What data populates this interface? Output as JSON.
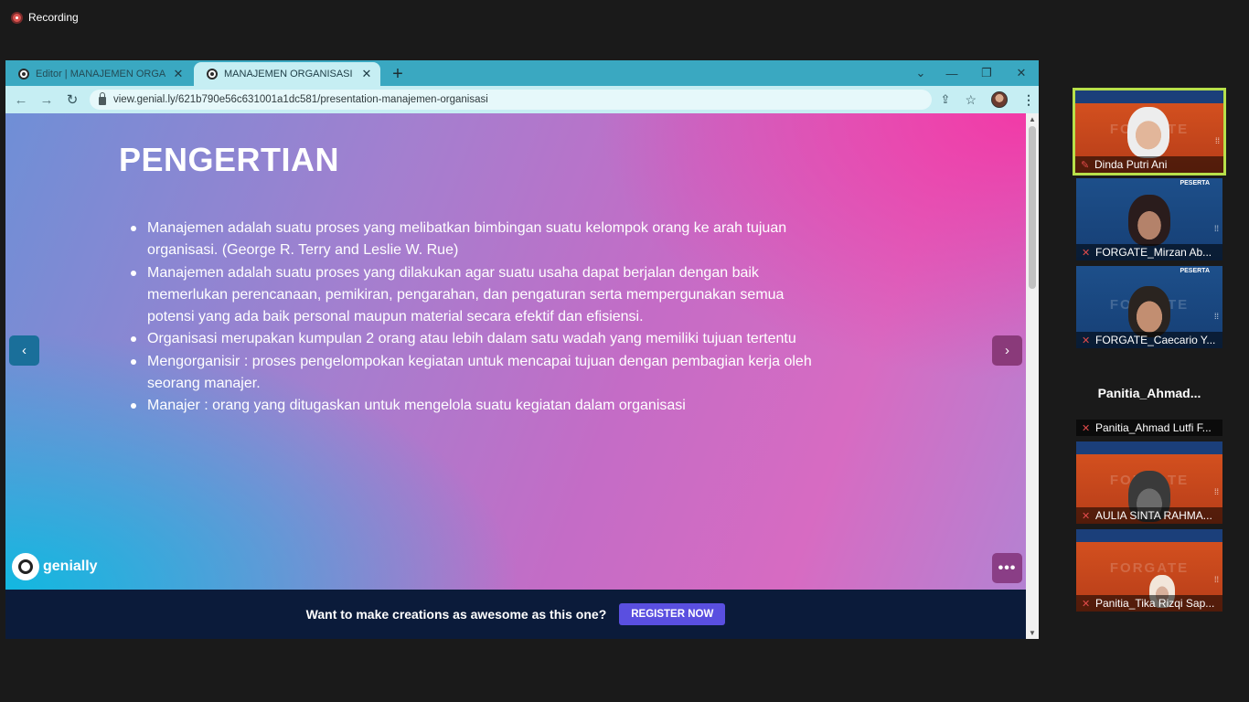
{
  "recording": {
    "label": "Recording"
  },
  "browser": {
    "tabs": [
      {
        "title": "Editor | MANAJEMEN ORGANISA",
        "active": false
      },
      {
        "title": "MANAJEMEN ORGANISASI by Di",
        "active": true
      }
    ],
    "url": "view.genial.ly/621b790e56c631001a1dc581/presentation-manajemen-organisasi"
  },
  "slide": {
    "title": "PENGERTIAN",
    "bullets": [
      "Manajemen adalah suatu proses yang melibatkan bimbingan suatu kelompok orang ke arah tujuan organisasi. (George R. Terry and Leslie W. Rue)",
      "Manajemen adalah suatu proses yang dilakukan agar suatu usaha dapat berjalan dengan baik memerlukan perencanaan, pemikiran, pengarahan, dan pengaturan serta mempergunakan semua potensi yang ada baik personal maupun material secara efektif dan efisiensi.",
      "Organisasi merupakan kumpulan 2 orang atau lebih dalam satu wadah yang memiliki tujuan tertentu",
      "Mengorganisir : proses pengelompokan kegiatan untuk mencapai tujuan dengan pembagian kerja oleh seorang manajer.",
      "Manajer : orang yang ditugaskan untuk mengelola suatu kegiatan dalam organisasi"
    ],
    "brand": "genially"
  },
  "promo": {
    "text": "Want to make creations as awesome as this one?",
    "button": "REGISTER NOW"
  },
  "participants": [
    {
      "name": "Dinda Putri Ani",
      "active": true,
      "watermark": "FORGATE"
    },
    {
      "name": "FORGATE_Mirzan Ab...",
      "active": false,
      "badge": "PESERTA"
    },
    {
      "name": "FORGATE_Caecario Y...",
      "active": false,
      "badge": "PESERTA",
      "watermark": "FORGATE"
    },
    {
      "name": "Panitia_Ahmad Lutfi F...",
      "active": false,
      "display": "Panitia_Ahmad..."
    },
    {
      "name": "AULIA SINTA RAHMA...",
      "active": false,
      "watermark": "FORGATE"
    },
    {
      "name": "Panitia_Tika Rizqi Sap...",
      "active": false,
      "watermark": "FORGATE"
    }
  ],
  "colors": {
    "slide_pink": "#f23aa7",
    "slide_cyan": "#12b8e0",
    "promo_bg": "#0b1b3a",
    "register_btn": "#5a4fe0",
    "active_speaker": "#b7e04a",
    "tab_bar": "#3aa8c1"
  }
}
